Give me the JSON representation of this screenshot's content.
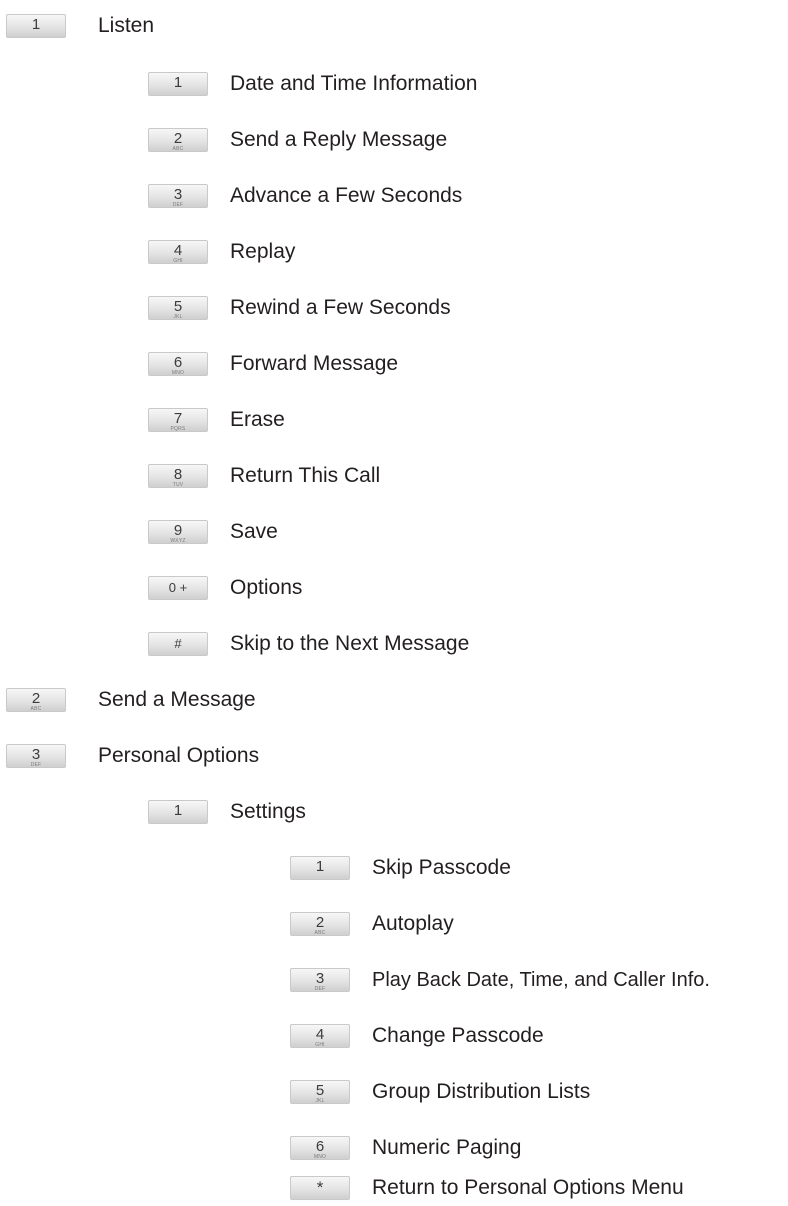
{
  "items": [
    {
      "key": "1",
      "letters": "",
      "label": "Listen"
    },
    {
      "key": "1",
      "letters": "",
      "label": "Date and Time Information"
    },
    {
      "key": "2",
      "letters": "ABC",
      "label": "Send a Reply Message"
    },
    {
      "key": "3",
      "letters": "DEF",
      "label": "Advance a Few Seconds"
    },
    {
      "key": "4",
      "letters": "GHI",
      "label": "Replay"
    },
    {
      "key": "5",
      "letters": "JKL",
      "label": "Rewind a Few Seconds"
    },
    {
      "key": "6",
      "letters": "MNO",
      "label": "Forward Message"
    },
    {
      "key": "7",
      "letters": "PQRS",
      "label": "Erase"
    },
    {
      "key": "8",
      "letters": "TUV",
      "label": "Return This Call"
    },
    {
      "key": "9",
      "letters": "WXYZ",
      "label": "Save"
    },
    {
      "key": "0 +",
      "letters": "",
      "label": "Options"
    },
    {
      "key": "#",
      "letters": "",
      "label": "Skip to the Next Message"
    },
    {
      "key": "2",
      "letters": "ABC",
      "label": "Send a Message"
    },
    {
      "key": "3",
      "letters": "DEF",
      "label": "Personal Options"
    },
    {
      "key": "1",
      "letters": "",
      "label": "Settings"
    },
    {
      "key": "1",
      "letters": "",
      "label": "Skip Passcode"
    },
    {
      "key": "2",
      "letters": "ABC",
      "label": "Autoplay"
    },
    {
      "key": "3",
      "letters": "DEF",
      "label": "Play Back Date, Time, and Caller Info."
    },
    {
      "key": "4",
      "letters": "GHI",
      "label": "Change Passcode"
    },
    {
      "key": "5",
      "letters": "JKL",
      "label": "Group Distribution Lists"
    },
    {
      "key": "6",
      "letters": "MNO",
      "label": "Numeric Paging"
    },
    {
      "key": "*",
      "letters": "",
      "label": "Return to Personal Options Menu"
    }
  ]
}
